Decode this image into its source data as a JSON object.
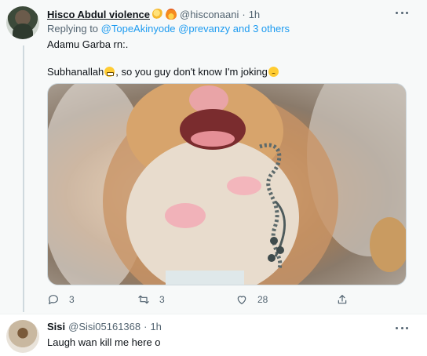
{
  "tweet": {
    "author_name": "Hisco Abdul violence",
    "author_emojis": [
      "dizzy-emoji",
      "fire-emoji"
    ],
    "handle": "@hisconaani",
    "separator": "·",
    "time": "1h",
    "replying_prefix": "Replying to",
    "replying_users": "@TopeAkinyode @prevanzy",
    "replying_and": "and",
    "replying_others": "3 others",
    "line1": "Adamu Garba rn:.",
    "line2_start": "Subhanallah",
    "line2_mid": ", so you guy don't know I'm joking",
    "media_description_icon": "hamster-image",
    "actions": {
      "reply_count": "3",
      "retweet_count": "3",
      "like_count": "28"
    }
  },
  "reply": {
    "author_name": "Sisi",
    "handle": "@Sisi05161368",
    "separator": "·",
    "time": "1h",
    "text": "Laugh wan kill me here o"
  },
  "colors": {
    "link": "#1d9bf0",
    "muted": "#536471",
    "thread_line": "#cfd9de",
    "hover_bg": "#f7f9f9"
  }
}
